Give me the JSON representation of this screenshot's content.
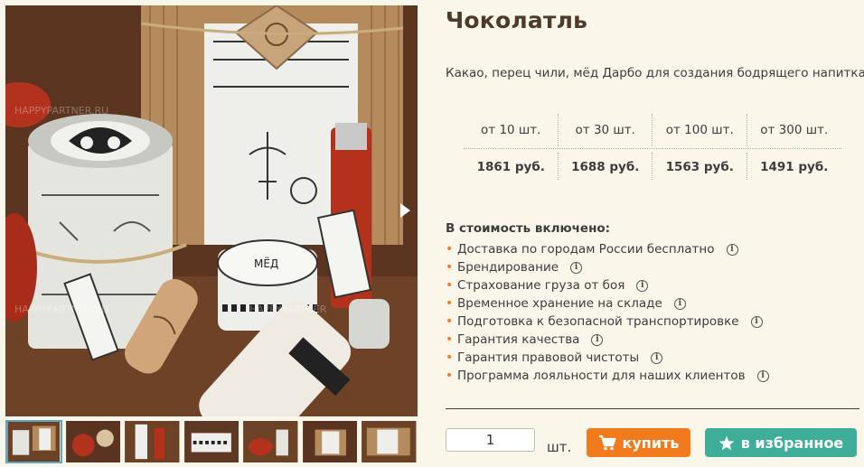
{
  "product": {
    "title": "Чоколатль",
    "description": "Какао, перец чили, мёд Дарбо для создания бодрящего напитка"
  },
  "price_table": {
    "quantities": [
      "от 10 шт.",
      "от 30 шт.",
      "от 100 шт.",
      "от 300 шт."
    ],
    "prices": [
      "1861 руб.",
      "1688 руб.",
      "1563 руб.",
      "1491 руб."
    ]
  },
  "included": {
    "title": "В стоимость включено:",
    "items": [
      "Доставка по городам России бесплатно",
      "Брендирование",
      "Страхование груза от боя",
      "Временное хранение на складе",
      "Подготовка к безопасной транспортировке",
      "Гарантия качества",
      "Гарантия правовой чистоты",
      "Программа лояльности для наших клиентов"
    ],
    "info_glyph": "i"
  },
  "order": {
    "quantity": "1",
    "unit": "шт.",
    "buy_label": "купить",
    "favorite_label": "в избранное"
  },
  "gallery": {
    "thumbnail_count": 7,
    "active_thumbnail": 1,
    "icons": [
      "chevron-right-icon",
      "cart-icon",
      "star-icon",
      "info-icon"
    ]
  },
  "colors": {
    "buy_button": "#f07a1c",
    "favorite_button": "#3fae98",
    "bullet": "#f07a1c",
    "title": "#4e3a2b",
    "background": "#fbf6ea"
  }
}
